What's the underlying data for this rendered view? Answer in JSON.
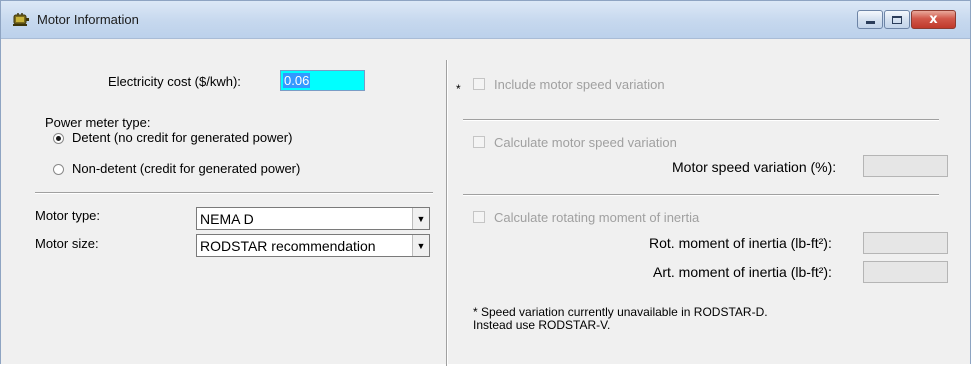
{
  "window": {
    "title": "Motor Information",
    "icon": "motor-app-icon",
    "caption_buttons": [
      "minimize",
      "maximize",
      "close"
    ],
    "close_glyph": "x"
  },
  "electricity": {
    "label": "Electricity cost ($/kwh):",
    "value": "0.06"
  },
  "power_meter": {
    "label": "Power meter type:",
    "options": [
      {
        "label": "Detent (no credit for generated power)",
        "selected": true
      },
      {
        "label": "Non-detent (credit for generated power)",
        "selected": false
      }
    ]
  },
  "motor_type": {
    "label": "Motor type:",
    "value": "NEMA D"
  },
  "motor_size": {
    "label": "Motor size:",
    "value": "RODSTAR recommendation"
  },
  "right_panel": {
    "asterisk": "*",
    "include_speed_variation": {
      "label": "Include motor speed variation",
      "checked": false,
      "enabled": false
    },
    "calculate_speed_variation": {
      "label": "Calculate motor speed variation",
      "checked": false,
      "enabled": false
    },
    "speed_variation_field": {
      "label": "Motor speed variation (%):",
      "value": ""
    },
    "calculate_inertia": {
      "label": "Calculate rotating moment of inertia",
      "checked": false,
      "enabled": false
    },
    "rot_inertia_field": {
      "label": "Rot. moment of inertia (lb-ft²):",
      "value": ""
    },
    "art_inertia_field": {
      "label": "Art. moment of inertia (lb-ft²):",
      "value": ""
    },
    "note_line1": "* Speed variation currently unavailable in RODSTAR-D.",
    "note_line2": "Instead use RODSTAR-V."
  },
  "colors": {
    "title_bar": "#c6d8ee",
    "background": "#f0f0f0",
    "cost_field": "#00ffff",
    "selection": "#3399ff",
    "disabled_text": "#a0a0a0",
    "close_button": "#c0392b"
  }
}
